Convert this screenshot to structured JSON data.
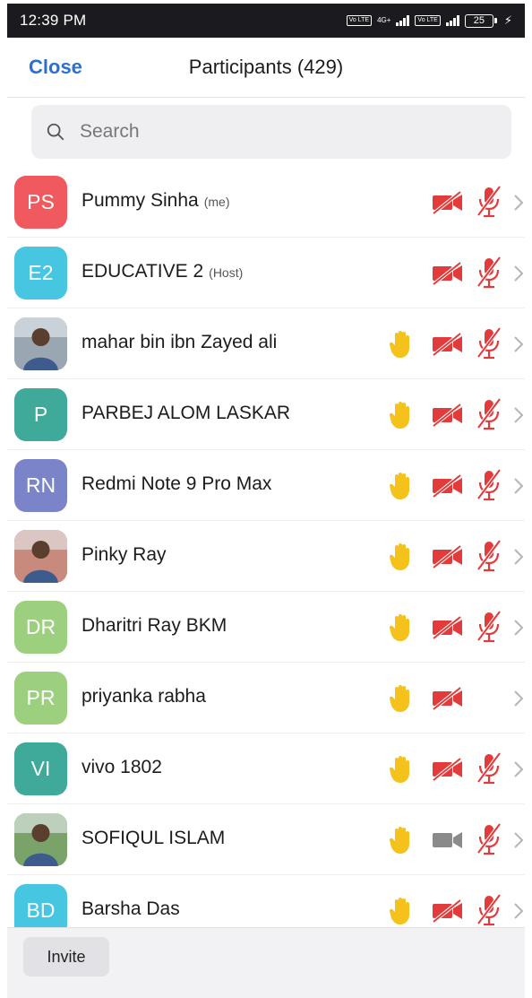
{
  "status_bar": {
    "time": "12:39 PM",
    "volte1": "Vo LTE",
    "net": "4G+",
    "volte2": "Vo LTE",
    "battery": "25"
  },
  "header": {
    "close_label": "Close",
    "title": "Participants (429)"
  },
  "search": {
    "placeholder": "Search"
  },
  "participants": [
    {
      "initials": "PS",
      "name": "Pummy Sinha",
      "role": "(me)",
      "avatar_color": "#f0595e",
      "photo": false,
      "hand": false,
      "video": "off",
      "mic": "off"
    },
    {
      "initials": "E2",
      "name": "EDUCATIVE 2",
      "role": "(Host)",
      "avatar_color": "#46c6e0",
      "photo": false,
      "hand": false,
      "video": "off",
      "mic": "off"
    },
    {
      "initials": "",
      "name": "mahar bin ibn Zayed ali",
      "role": "",
      "avatar_color": "#9aa7b3",
      "photo": true,
      "hand": true,
      "video": "off",
      "mic": "off"
    },
    {
      "initials": "P",
      "name": "PARBEJ  ALOM LASKAR",
      "role": "",
      "avatar_color": "#3fa99a",
      "photo": false,
      "hand": true,
      "video": "off",
      "mic": "off"
    },
    {
      "initials": "RN",
      "name": "Redmi Note 9 Pro Max",
      "role": "",
      "avatar_color": "#7b84c9",
      "photo": false,
      "hand": true,
      "video": "off",
      "mic": "off"
    },
    {
      "initials": "",
      "name": "Pinky Ray",
      "role": "",
      "avatar_color": "#c98a7e",
      "photo": true,
      "hand": true,
      "video": "off",
      "mic": "off"
    },
    {
      "initials": "DR",
      "name": "Dharitri Ray BKM",
      "role": "",
      "avatar_color": "#9ccf7e",
      "photo": false,
      "hand": true,
      "video": "off",
      "mic": "off"
    },
    {
      "initials": "PR",
      "name": "priyanka rabha",
      "role": "",
      "avatar_color": "#9ccf7e",
      "photo": false,
      "hand": true,
      "video": "off",
      "mic": "none"
    },
    {
      "initials": "VI",
      "name": "vivo 1802",
      "role": "",
      "avatar_color": "#3fa99a",
      "photo": false,
      "hand": true,
      "video": "off",
      "mic": "off"
    },
    {
      "initials": "",
      "name": "SOFIQUL ISLAM",
      "role": "",
      "avatar_color": "#7aa36a",
      "photo": true,
      "hand": true,
      "video": "on",
      "mic": "off"
    },
    {
      "initials": "BD",
      "name": "Barsha Das",
      "role": "",
      "avatar_color": "#46c6e0",
      "photo": false,
      "hand": true,
      "video": "off",
      "mic": "off"
    }
  ],
  "bottom": {
    "invite_label": "Invite"
  },
  "colors": {
    "accent": "#2a6fd4",
    "muted_red": "#e23b3b",
    "hand_yellow": "#f5c21b",
    "video_on_gray": "#8a8a8a"
  }
}
